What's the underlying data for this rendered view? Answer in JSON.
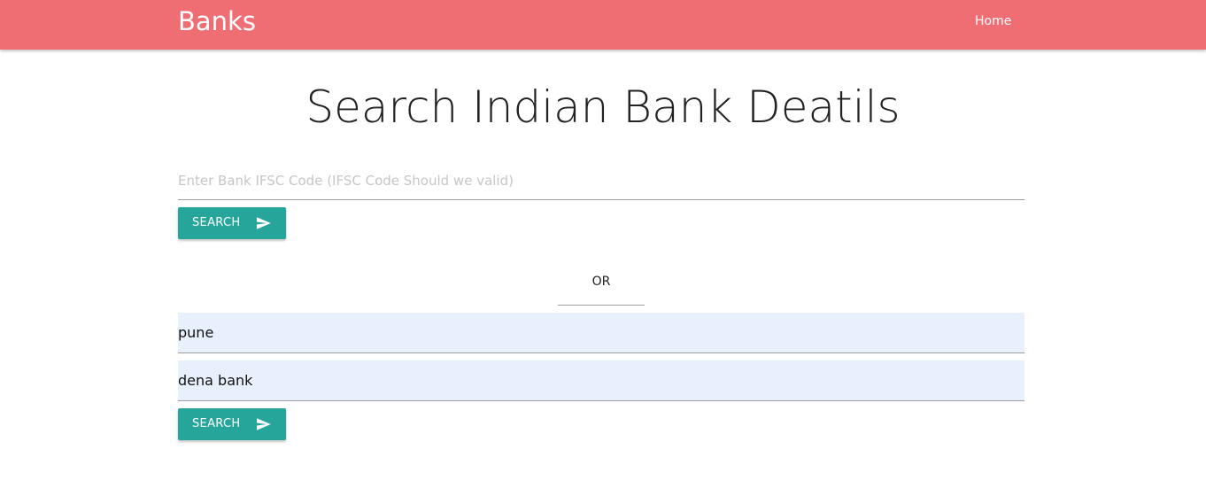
{
  "navbar": {
    "brand": "Banks",
    "home_label": "Home",
    "color": "#ef6e73"
  },
  "main": {
    "title": "Search Indian Bank Deatils",
    "ifsc_search": {
      "placeholder": "Enter Bank IFSC Code (IFSC Code Should we valid)",
      "value": "",
      "button_label": "SEARCH",
      "button_icon": "send-icon"
    },
    "or_label": "OR",
    "city_bank_search": {
      "city_value": "pune",
      "bank_value": "dena bank",
      "button_label": "SEARCH",
      "button_icon": "send-icon"
    },
    "accent_color": "#26a69a",
    "autofill_color": "#e8f0fe"
  }
}
